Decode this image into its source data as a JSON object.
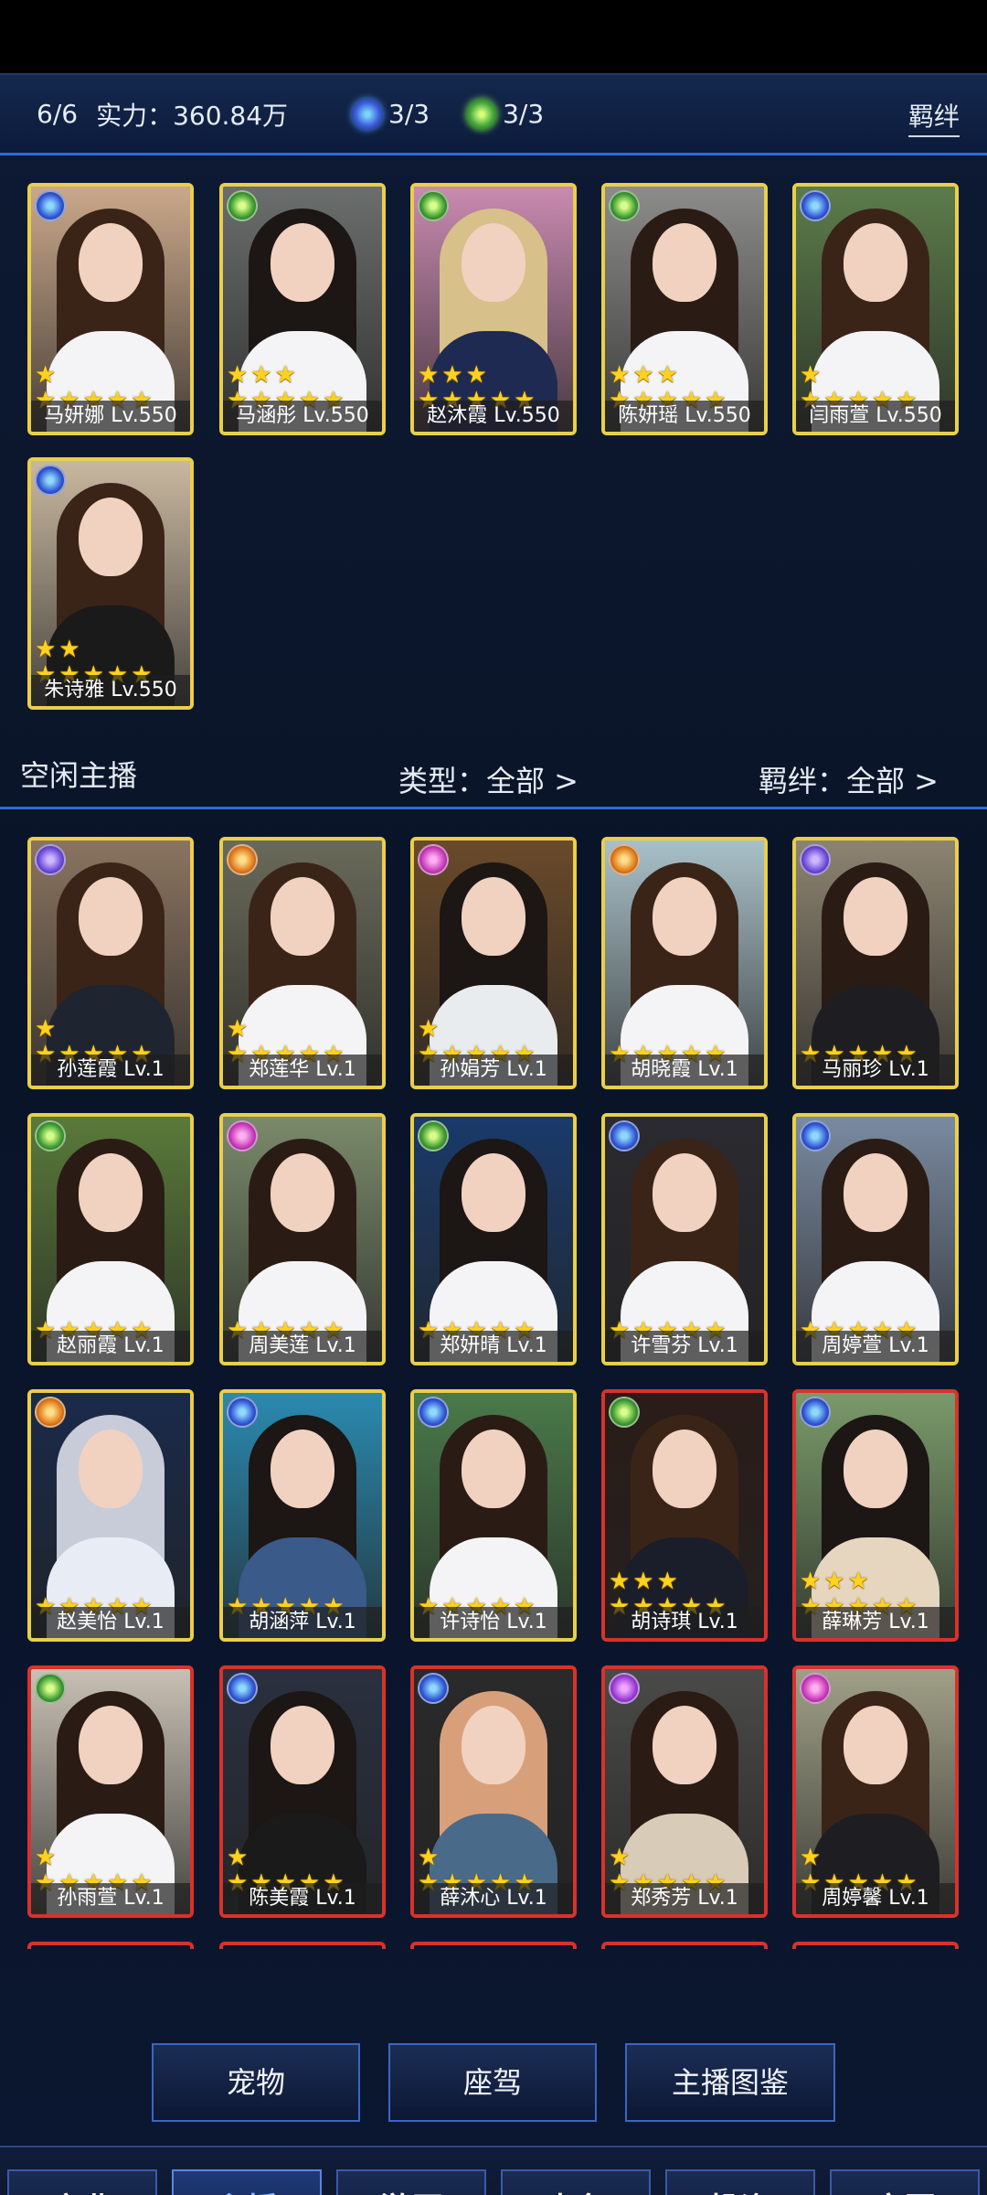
{
  "header": {
    "count": "6/6",
    "power": "实力：360.84万",
    "blue_resource": "3/3",
    "green_resource": "3/3",
    "bond_button": "羁绊"
  },
  "active_hosts": [
    {
      "name": "马妍娜 Lv.550",
      "frame": "yellow",
      "element": "blue",
      "stars": 6,
      "hair": "#3a2418",
      "bg": "#caa88a",
      "outfit": "#f4f4f6"
    },
    {
      "name": "马涵彤 Lv.550",
      "frame": "yellow",
      "element": "green",
      "stars": 8,
      "hair": "#1c1614",
      "bg": "#6a6e6c",
      "outfit": "#f4f4f6"
    },
    {
      "name": "赵沐霞 Lv.550",
      "frame": "yellow",
      "element": "green",
      "stars": 8,
      "hair": "#d8c08a",
      "bg": "#c98ab0",
      "outfit": "#1f2a52"
    },
    {
      "name": "陈妍瑶 Lv.550",
      "frame": "yellow",
      "element": "green",
      "stars": 8,
      "hair": "#2a1c14",
      "bg": "#8c8c8a",
      "outfit": "#f4f4f6"
    },
    {
      "name": "闫雨萱 Lv.550",
      "frame": "yellow",
      "element": "blue",
      "stars": 6,
      "hair": "#3a2418",
      "bg": "#5c7c4a",
      "outfit": "#f4f4f6"
    },
    {
      "name": "朱诗雅 Lv.550",
      "frame": "yellow",
      "element": "blue",
      "stars": 7,
      "hair": "#3a2418",
      "bg": "#c9b8a0",
      "outfit": "#1a1a1a"
    }
  ],
  "idle_bar": {
    "title": "空闲主播",
    "type_filter": "类型：全部 >",
    "bond_filter": "羁绊：全部 >"
  },
  "idle_hosts": [
    {
      "name": "孙莲霞 Lv.1",
      "frame": "yellow",
      "element": "violet",
      "stars": 6,
      "hair": "#3a2418",
      "bg": "#8a7460",
      "outfit": "#1e2430"
    },
    {
      "name": "郑莲华 Lv.1",
      "frame": "yellow",
      "element": "orange",
      "stars": 6,
      "hair": "#3a2418",
      "bg": "#6a6a5a",
      "outfit": "#f4f4f6"
    },
    {
      "name": "孙娟芳 Lv.1",
      "frame": "yellow",
      "element": "magenta",
      "stars": 6,
      "hair": "#1c1614",
      "bg": "#6a4a2a",
      "outfit": "#e8ecef"
    },
    {
      "name": "胡晓霞 Lv.1",
      "frame": "yellow",
      "element": "orange",
      "stars": 5,
      "hair": "#3a2418",
      "bg": "#a9c0c8",
      "outfit": "#f4f4f6"
    },
    {
      "name": "马丽珍 Lv.1",
      "frame": "yellow",
      "element": "violet",
      "stars": 5,
      "hair": "#2a1c14",
      "bg": "#8c8470",
      "outfit": "#1e1e22"
    },
    {
      "name": "赵丽霞 Lv.1",
      "frame": "yellow",
      "element": "green",
      "stars": 5,
      "hair": "#2a1c14",
      "bg": "#5a7a3a",
      "outfit": "#f4f4f6"
    },
    {
      "name": "周美莲 Lv.1",
      "frame": "yellow",
      "element": "magenta",
      "stars": 5,
      "hair": "#2a1c14",
      "bg": "#7a8a6a",
      "outfit": "#f4f4f6"
    },
    {
      "name": "郑妍晴 Lv.1",
      "frame": "yellow",
      "element": "green",
      "stars": 5,
      "hair": "#1c1614",
      "bg": "#1a3a6a",
      "outfit": "#f4f4f6"
    },
    {
      "name": "许雪芬 Lv.1",
      "frame": "yellow",
      "element": "blue",
      "stars": 5,
      "hair": "#3a2418",
      "bg": "#2a2a30",
      "outfit": "#f4f4f6"
    },
    {
      "name": "周婷萱 Lv.1",
      "frame": "yellow",
      "element": "blue",
      "stars": 5,
      "hair": "#2a1c14",
      "bg": "#7a8aa0",
      "outfit": "#f4f4f6"
    },
    {
      "name": "赵美怡 Lv.1",
      "frame": "yellow",
      "element": "orange",
      "stars": 5,
      "hair": "#c8ccd8",
      "bg": "#1a2a4a",
      "outfit": "#e8ecf4"
    },
    {
      "name": "胡涵萍 Lv.1",
      "frame": "yellow",
      "element": "blue",
      "stars": 5,
      "hair": "#1c1614",
      "bg": "#2a8ab0",
      "outfit": "#3a5a8a"
    },
    {
      "name": "许诗怡 Lv.1",
      "frame": "yellow",
      "element": "blue",
      "stars": 5,
      "hair": "#2a1c14",
      "bg": "#4a7a4a",
      "outfit": "#f4f4f6"
    },
    {
      "name": "胡诗琪 Lv.1",
      "frame": "red",
      "element": "green",
      "stars": 8,
      "hair": "#3a2418",
      "bg": "#2a1c18",
      "outfit": "#1a1e2a"
    },
    {
      "name": "薛琳芳 Lv.1",
      "frame": "red",
      "element": "blue",
      "stars": 8,
      "hair": "#1c1614",
      "bg": "#7a9a6a",
      "outfit": "#e6d6c0"
    },
    {
      "name": "孙雨萱 Lv.1",
      "frame": "red",
      "element": "green",
      "stars": 6,
      "hair": "#2a1c14",
      "bg": "#c8c0b4",
      "outfit": "#f4f4f6"
    },
    {
      "name": "陈美霞 Lv.1",
      "frame": "red",
      "element": "blue",
      "stars": 6,
      "hair": "#1c1614",
      "bg": "#2a3040",
      "outfit": "#1a1a1a"
    },
    {
      "name": "薛沐心 Lv.1",
      "frame": "red",
      "element": "blue",
      "stars": 6,
      "hair": "#d8a07a",
      "bg": "#2a2a2a",
      "outfit": "#4a6a8a"
    },
    {
      "name": "郑秀芳 Lv.1",
      "frame": "red",
      "element": "purple",
      "stars": 6,
      "hair": "#2a1c14",
      "bg": "#4a4a48",
      "outfit": "#d8ccb8"
    },
    {
      "name": "周婷馨 Lv.1",
      "frame": "red",
      "element": "magenta",
      "stars": 6,
      "hair": "#3a2418",
      "bg": "#a0a088",
      "outfit": "#1e1e22"
    }
  ],
  "sub_buttons": [
    "宠物",
    "座驾",
    "主播图鉴"
  ],
  "nav": {
    "items": [
      "产业",
      "主播",
      "游历",
      "事务",
      "投资",
      "家园"
    ],
    "active": 1
  }
}
